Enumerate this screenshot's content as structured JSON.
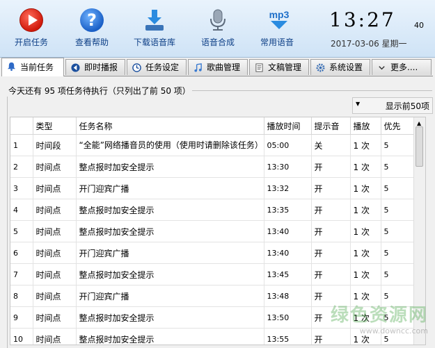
{
  "toolbar": {
    "buttons": [
      {
        "label": "开启任务",
        "icon": "play-icon"
      },
      {
        "label": "查看帮助",
        "icon": "help-icon"
      },
      {
        "label": "下载语音库",
        "icon": "download-icon"
      },
      {
        "label": "语音合成",
        "icon": "microphone-icon"
      },
      {
        "label": "常用语音",
        "icon": "mp3-icon"
      }
    ]
  },
  "clock": {
    "time": "13:27",
    "seconds": "40",
    "date": "2017-03-06  星期一"
  },
  "tabs": [
    {
      "label": "当前任务",
      "icon": "bell-icon"
    },
    {
      "label": "即时播报",
      "icon": "speaker-icon"
    },
    {
      "label": "任务设定",
      "icon": "clock-icon"
    },
    {
      "label": "歌曲管理",
      "icon": "music-note-icon"
    },
    {
      "label": "文稿管理",
      "icon": "document-icon"
    },
    {
      "label": "系统设置",
      "icon": "gear-icon"
    },
    {
      "label": "更多....",
      "icon": "chevron-down-icon"
    }
  ],
  "panel": {
    "title": "今天还有 95 项任务待执行（只列出了前 50 项）",
    "dropdown_value": "显示前50项"
  },
  "table": {
    "headers": [
      "",
      "类型",
      "任务名称",
      "播放时间",
      "提示音",
      "播放",
      "优先"
    ],
    "rows": [
      [
        "1",
        "时间段",
        "“全能”网络播音员的使用（使用时请删除该任务）",
        "05:00",
        "关",
        "1 次",
        "5"
      ],
      [
        "2",
        "时间点",
        "整点报时加安全提示",
        "13:30",
        "开",
        "1 次",
        "5"
      ],
      [
        "3",
        "时间点",
        "开门迎宾广播",
        "13:32",
        "开",
        "1 次",
        "5"
      ],
      [
        "4",
        "时间点",
        "整点报时加安全提示",
        "13:35",
        "开",
        "1 次",
        "5"
      ],
      [
        "5",
        "时间点",
        "整点报时加安全提示",
        "13:40",
        "开",
        "1 次",
        "5"
      ],
      [
        "6",
        "时间点",
        "开门迎宾广播",
        "13:40",
        "开",
        "1 次",
        "5"
      ],
      [
        "7",
        "时间点",
        "整点报时加安全提示",
        "13:45",
        "开",
        "1 次",
        "5"
      ],
      [
        "8",
        "时间点",
        "开门迎宾广播",
        "13:48",
        "开",
        "1 次",
        "5"
      ],
      [
        "9",
        "时间点",
        "整点报时加安全提示",
        "13:50",
        "开",
        "1 次",
        "5"
      ],
      [
        "10",
        "时间点",
        "整点报时加安全提示",
        "13:55",
        "开",
        "1 次",
        "5"
      ]
    ]
  },
  "watermark": {
    "line1": "绿色资源网",
    "line2": "www.downcc.com"
  },
  "colors": {
    "toolbar_label": "#0d3f86",
    "play": "#d01a0b",
    "help": "#1a5fc6",
    "accent": "#2f7fd8"
  }
}
